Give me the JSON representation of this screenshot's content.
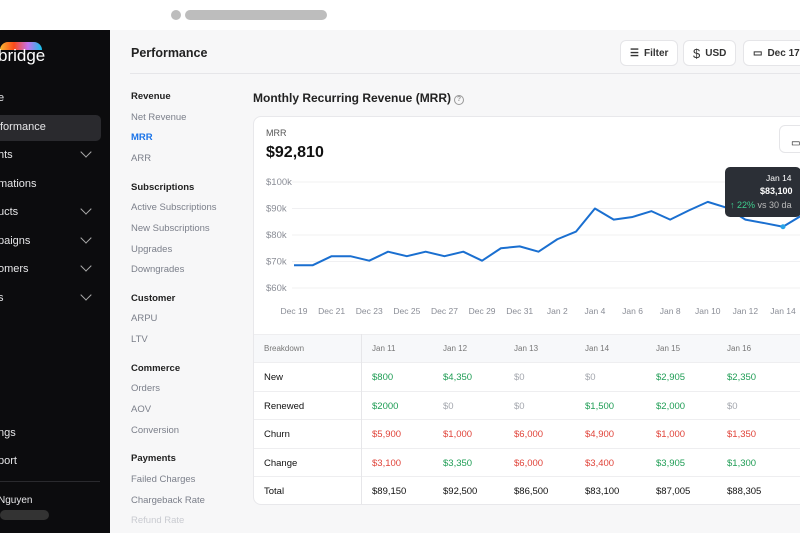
{
  "app": {
    "logo_text": "bridge"
  },
  "sidebar": {
    "items": [
      {
        "label": "e",
        "chevron": false,
        "active": false
      },
      {
        "label": "formance",
        "chevron": false,
        "active": true
      },
      {
        "label": "hts",
        "chevron": true,
        "active": false
      },
      {
        "label": "mations",
        "chevron": false,
        "active": false
      },
      {
        "label": "ucts",
        "chevron": true,
        "active": false
      },
      {
        "label": "paigns",
        "chevron": true,
        "active": false
      },
      {
        "label": "omers",
        "chevron": true,
        "active": false
      },
      {
        "label": "s",
        "chevron": true,
        "active": false
      }
    ],
    "bottom": [
      {
        "label": "ngs"
      },
      {
        "label": "port"
      }
    ],
    "user": "Nguyen"
  },
  "header": {
    "title": "Performance",
    "filter": "Filter",
    "currency": "USD",
    "date": "Dec 17"
  },
  "subnav": [
    {
      "heading": "Revenue",
      "items": [
        "Net Revenue",
        "MRR",
        "ARR"
      ]
    },
    {
      "heading": "Subscriptions",
      "items": [
        "Active Subscriptions",
        "New Subscriptions",
        "Upgrades",
        "Downgrades"
      ]
    },
    {
      "heading": "Customer",
      "items": [
        "ARPU",
        "LTV"
      ]
    },
    {
      "heading": "Commerce",
      "items": [
        "Orders",
        "AOV",
        "Conversion"
      ]
    },
    {
      "heading": "Payments",
      "items": [
        "Failed Charges",
        "Chargeback Rate",
        "Refund Rate"
      ]
    }
  ],
  "subnav_active": "MRR",
  "card": {
    "title": "Monthly Recurring Revenue (MRR)",
    "metric_label": "MRR",
    "metric_value": "$92,810",
    "tooltip": {
      "date": "Jan 14",
      "value": "$83,100",
      "change": "22%",
      "compare": "vs 30 da"
    }
  },
  "colors": {
    "line": "#1a6fd0",
    "positive": "#1f9d55",
    "negative": "#e0443a"
  },
  "chart_data": {
    "type": "line",
    "x": [
      "Dec 19",
      "Dec 20",
      "Dec 21",
      "Dec 22",
      "Dec 23",
      "Dec 24",
      "Dec 25",
      "Dec 26",
      "Dec 27",
      "Dec 28",
      "Dec 29",
      "Dec 30",
      "Dec 31",
      "Jan 1",
      "Jan 2",
      "Jan 3",
      "Jan 4",
      "Jan 5",
      "Jan 6",
      "Jan 7",
      "Jan 8",
      "Jan 9",
      "Jan 10",
      "Jan 11",
      "Jan 12",
      "Jan 13",
      "Jan 14",
      "Jan 15"
    ],
    "series": [
      {
        "values": [
          68600,
          68600,
          72000,
          72000,
          70300,
          73700,
          72000,
          73700,
          72000,
          73700,
          70300,
          75000,
          75700,
          73700,
          78400,
          81300,
          90000,
          85800,
          86800,
          89000,
          85800,
          89300,
          92500,
          90300,
          85800,
          84500,
          83100,
          87400
        ]
      }
    ],
    "xticks": [
      "Dec 19",
      "Dec 21",
      "Dec 23",
      "Dec 25",
      "Dec 27",
      "Dec 29",
      "Dec 31",
      "Jan 2",
      "Jan 4",
      "Jan 6",
      "Jan 8",
      "Jan 10",
      "Jan 12",
      "Jan 14"
    ],
    "yticks": [
      "$60k",
      "$70k",
      "$80k",
      "$90k",
      "$100k"
    ],
    "ylim": [
      60000,
      100000
    ],
    "grid": true,
    "highlight": "Jan 14"
  },
  "table": {
    "header": "Breakdown",
    "columns": [
      "Jan 11",
      "Jan 12",
      "Jan 13",
      "Jan 14",
      "Jan 15",
      "Jan 16"
    ],
    "rows": [
      {
        "label": "New",
        "values": [
          "$800",
          "$4,350",
          "$0",
          "$0",
          "$2,905",
          "$2,350"
        ],
        "tones": [
          "pos",
          "pos",
          "zero",
          "zero",
          "pos",
          "pos"
        ]
      },
      {
        "label": "Renewed",
        "values": [
          "$2000",
          "$0",
          "$0",
          "$1,500",
          "$2,000",
          "$0"
        ],
        "tones": [
          "pos",
          "zero",
          "zero",
          "pos",
          "pos",
          "zero"
        ]
      },
      {
        "label": "Churn",
        "values": [
          "$5,900",
          "$1,000",
          "$6,000",
          "$4,900",
          "$1,000",
          "$1,350"
        ],
        "tones": [
          "neg",
          "neg",
          "neg",
          "neg",
          "neg",
          "neg"
        ]
      },
      {
        "label": "Change",
        "values": [
          "$3,100",
          "$3,350",
          "$6,000",
          "$3,400",
          "$3,905",
          "$1,300"
        ],
        "tones": [
          "neg",
          "pos",
          "neg",
          "neg",
          "pos",
          "pos"
        ]
      },
      {
        "label": "Total",
        "values": [
          "$89,150",
          "$92,500",
          "$86,500",
          "$83,100",
          "$87,005",
          "$88,305"
        ],
        "tones": [
          "tot",
          "tot",
          "tot",
          "tot",
          "tot",
          "tot"
        ]
      }
    ]
  }
}
